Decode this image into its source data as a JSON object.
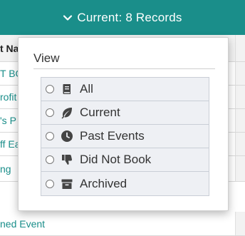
{
  "header": {
    "title": "Current: 8 Records",
    "icon": "chevron-down-icon"
  },
  "table": {
    "header_fragment": "t Na",
    "rows": [
      "T BO",
      "rofit",
      "'s P",
      "ff Ea",
      "ng",
      "ned Event"
    ]
  },
  "popover": {
    "title": "View",
    "options": [
      {
        "label": "All",
        "icon": "book-icon"
      },
      {
        "label": "Current",
        "icon": "leaf-icon"
      },
      {
        "label": "Past Events",
        "icon": "clock-icon"
      },
      {
        "label": "Did Not Book",
        "icon": "thumbs-down-icon"
      },
      {
        "label": "Archived",
        "icon": "archive-box-icon"
      }
    ]
  },
  "colors": {
    "accent": "#1a8e8a",
    "icon": "#444444"
  }
}
